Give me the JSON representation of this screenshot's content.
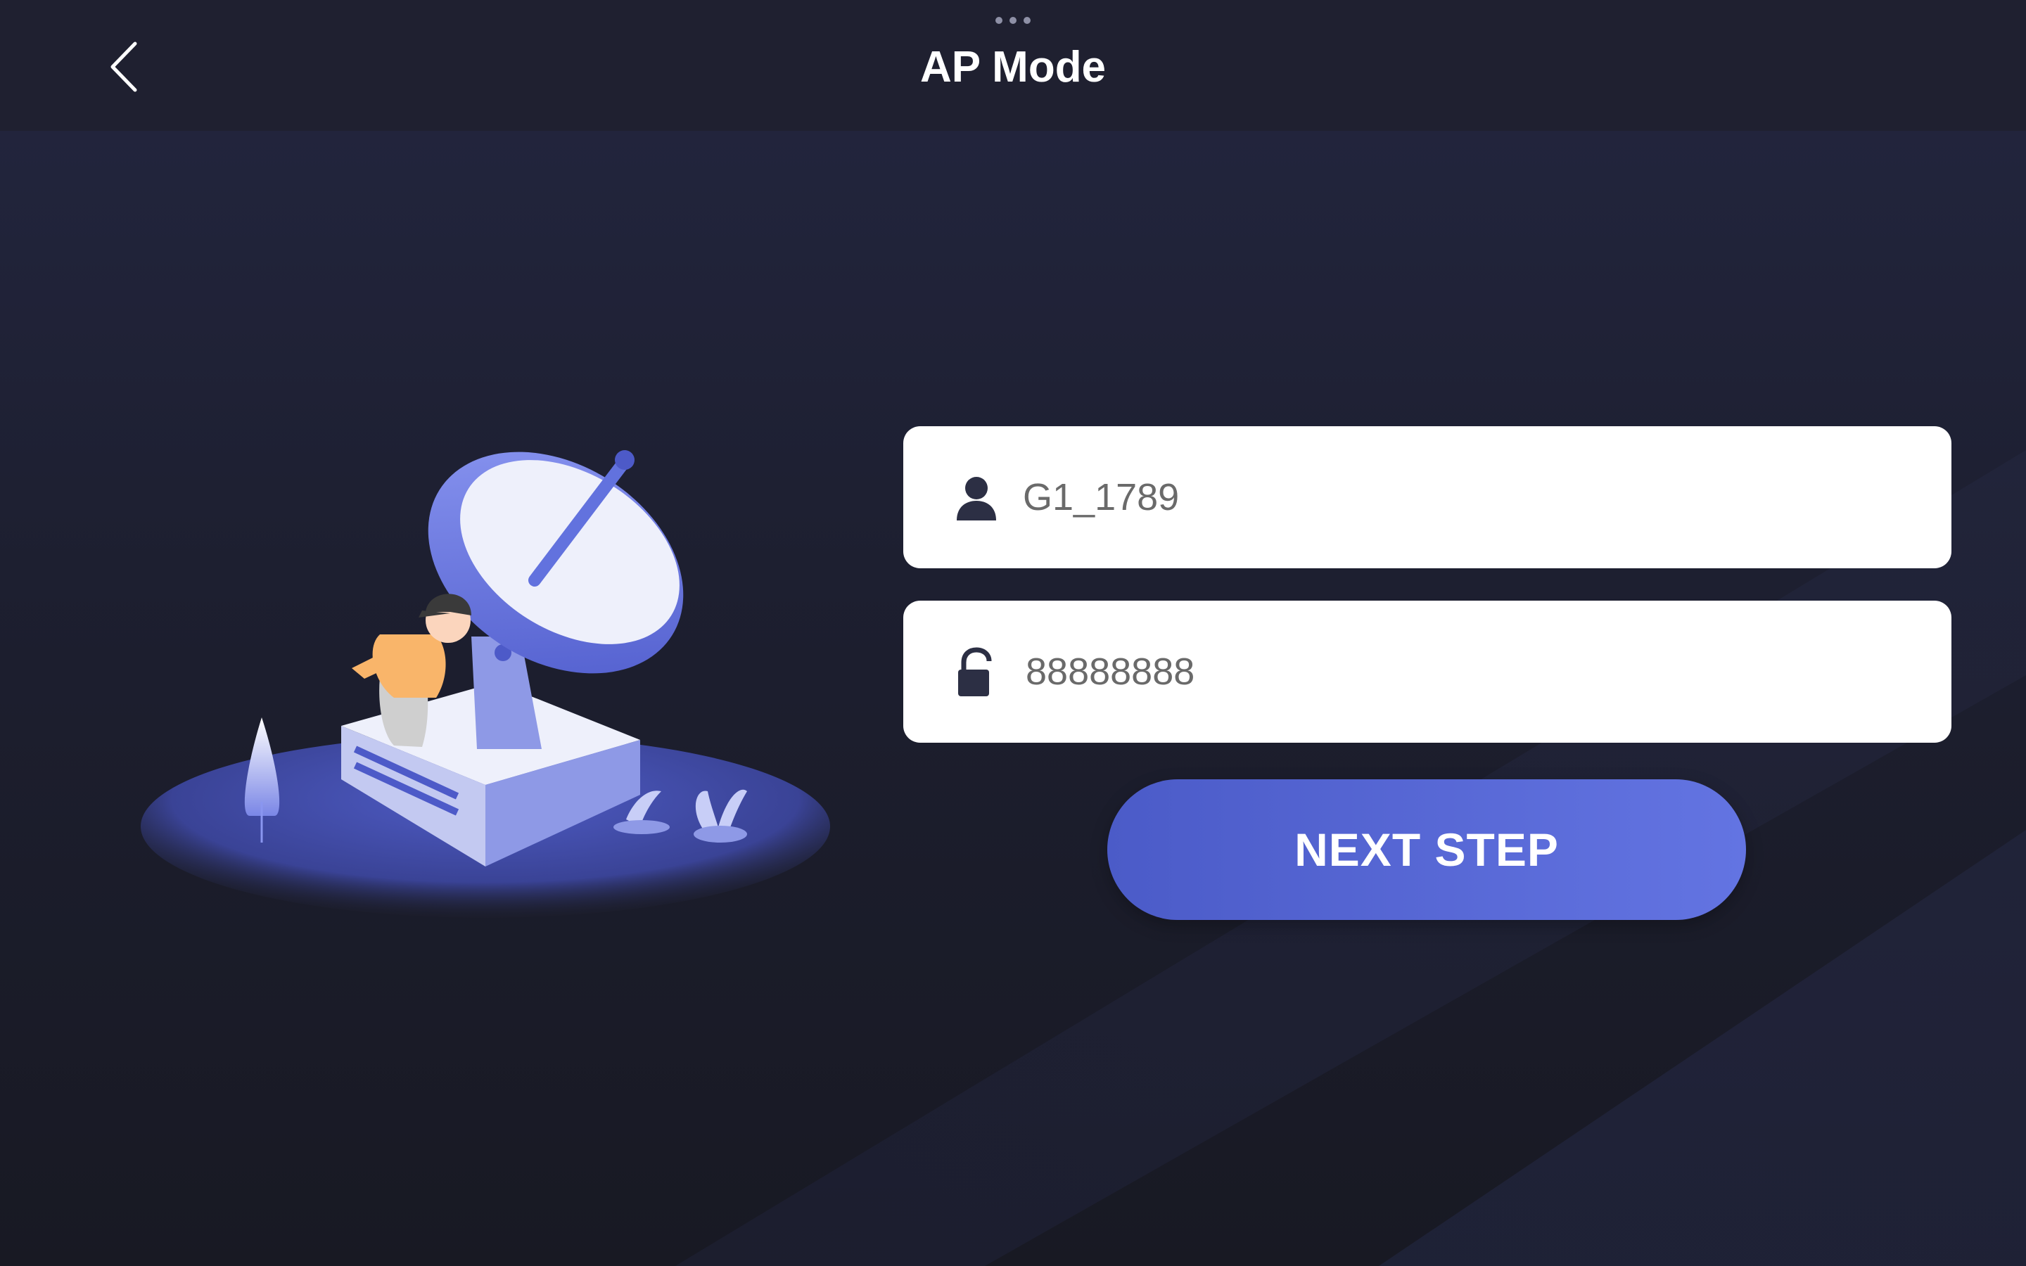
{
  "header": {
    "title": "AP Mode",
    "back_icon": "chevron-left-icon",
    "grip_icon": "more-dots-icon"
  },
  "form": {
    "username": {
      "icon": "user-icon",
      "value": "G1_1789"
    },
    "password": {
      "icon": "lock-icon",
      "value": "88888888"
    },
    "next_label": "NEXT STEP"
  },
  "colors": {
    "background": "#1d1f30",
    "header": "#1f2030",
    "accent": "#5a6ad8",
    "field_bg": "#ffffff",
    "field_text": "#6a6a6a"
  }
}
